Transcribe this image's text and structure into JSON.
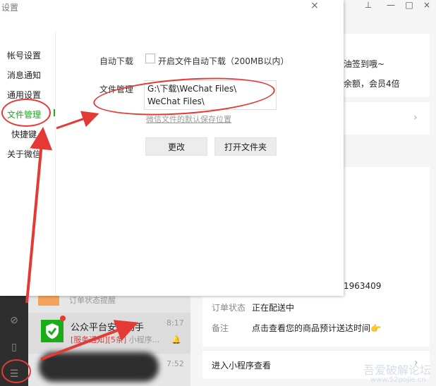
{
  "dialog": {
    "title": "设置",
    "close_glyph": "×"
  },
  "sidebar": {
    "items": [
      {
        "label": "帐号设置"
      },
      {
        "label": "消息通知"
      },
      {
        "label": "通用设置"
      },
      {
        "label": "文件管理"
      },
      {
        "label": "快捷键"
      },
      {
        "label": "关于微信"
      }
    ]
  },
  "file_settings": {
    "auto_download_label": "自动下载",
    "auto_download_option": "开启文件自动下载（200MB以内）",
    "file_manage_label": "文件管理",
    "path_line1": "G:\\下载\\WeChat Files\\",
    "path_line2": "WeChat Files\\",
    "hint": "微信文件的默认保存位置",
    "change_button": "更改",
    "open_folder_button": "打开文件夹"
  },
  "background": {
    "win_pin": "⊥",
    "win_min": "—",
    "win_max": "□",
    "win_close": "×",
    "promo_line1": "油签到哦~",
    "promo_line2": "余额，会员4倍",
    "order_number_fragment": "1963409",
    "order_status_label": "订单状态",
    "order_status_value": "正在配送中",
    "remark_label": "备注",
    "remark_value": "点击查看您的商品预计送达时间👉",
    "enter_mini": "进入小程序查看",
    "chat_prev": "订单状态提醒",
    "chat_name": "公众平台安全助手",
    "chat_time": "8:17",
    "chat_preview_tag": "[服务通知][5条]",
    "chat_preview_text": " 小程序...",
    "chat_time2": "7:52"
  },
  "watermark": {
    "line1": "吾爱破解论坛",
    "line2": "www.52pojie.cn"
  },
  "colors": {
    "accent": "#1aad19",
    "annotation": "#e53935"
  }
}
